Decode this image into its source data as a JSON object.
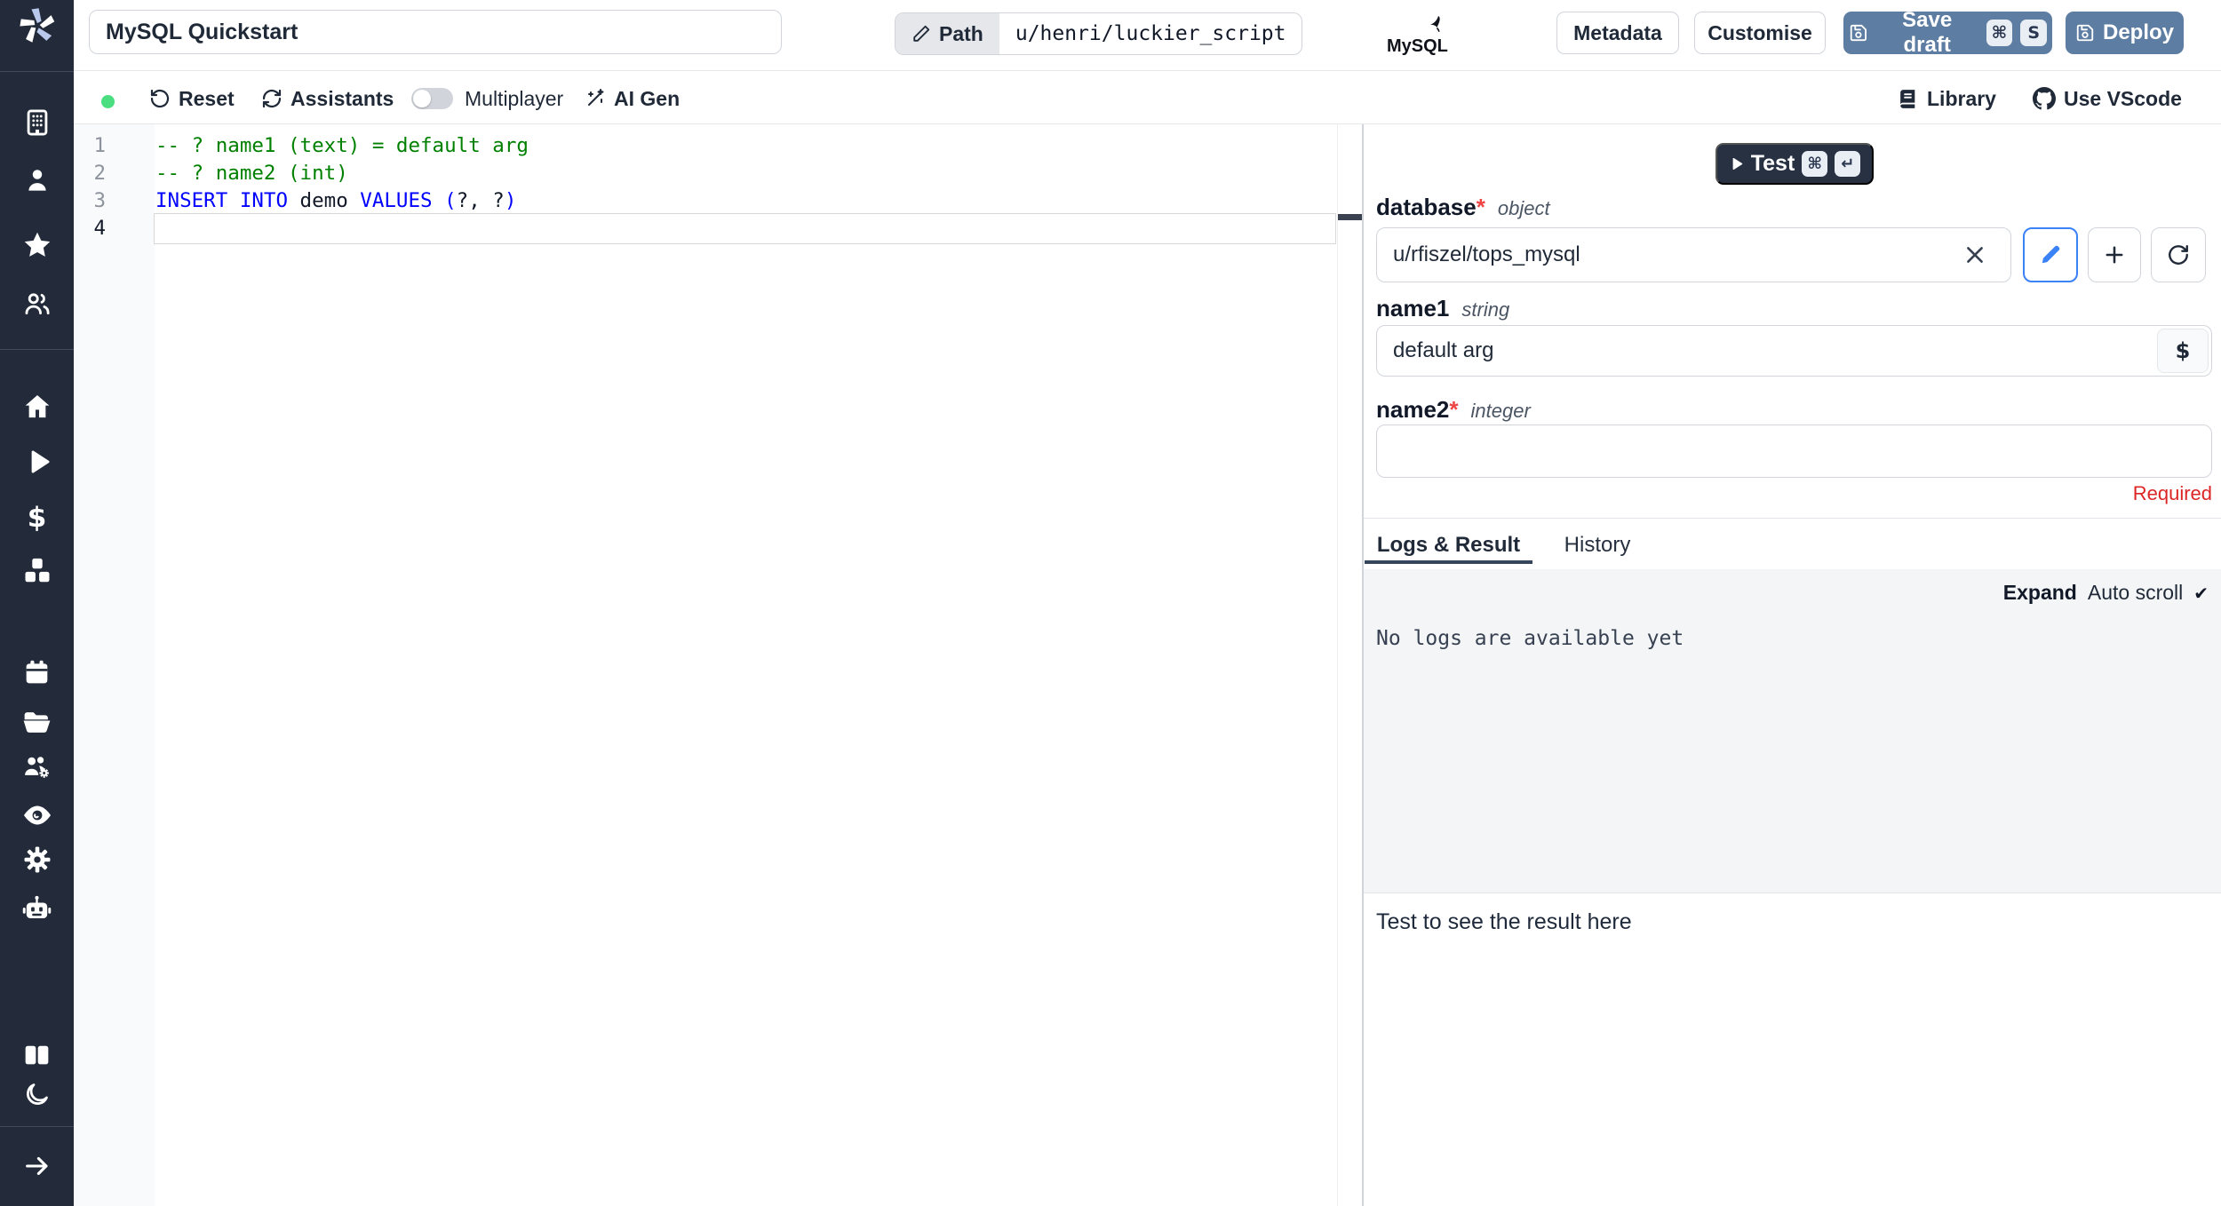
{
  "topbar": {
    "title_value": "MySQL Quickstart",
    "path_label": "Path",
    "path_value": "u/henri/luckier_script",
    "language_logo_text": "MySQL",
    "metadata_label": "Metadata",
    "customise_label": "Customise",
    "save_draft_label": "Save draft",
    "save_draft_kbd1": "⌘",
    "save_draft_kbd2": "S",
    "deploy_label": "Deploy"
  },
  "toolbar": {
    "reset_label": "Reset",
    "assistants_label": "Assistants",
    "multiplayer_label": "Multiplayer",
    "ai_gen_label": "AI Gen",
    "library_label": "Library",
    "vscode_label": "Use VScode"
  },
  "editor": {
    "line_numbers": [
      "1",
      "2",
      "3",
      "4"
    ],
    "line1": "-- ? name1 (text) = default arg",
    "line2": "-- ? name2 (int)",
    "l3_kw1": "INSERT INTO",
    "l3_id": " demo ",
    "l3_kw2": "VALUES",
    "l3_p1": " (",
    "l3_q": "?, ?",
    "l3_p2": ")"
  },
  "panel": {
    "test_label": "Test",
    "test_kbd1": "⌘",
    "test_kbd2": "↵",
    "fields": {
      "database": {
        "name": "database",
        "required": "*",
        "type": "object",
        "value": "u/rfiszel/tops_mysql"
      },
      "name1": {
        "name": "name1",
        "type": "string",
        "value": "default arg",
        "var_button": "$"
      },
      "name2": {
        "name": "name2",
        "required": "*",
        "type": "integer",
        "value": "",
        "error": "Required"
      }
    },
    "tabs": {
      "logs": "Logs & Result",
      "history": "History"
    },
    "logs": {
      "expand_label": "Expand",
      "autoscroll_label": "Auto scroll",
      "check": "✔",
      "empty_text": "No logs are available yet"
    },
    "result_placeholder": "Test to see the result here"
  },
  "sidebar": {
    "icon_names": [
      "windmill-logo",
      "workspace",
      "user",
      "favorites",
      "groups",
      "home",
      "runs",
      "billing",
      "resources",
      "schedules",
      "folders",
      "workers",
      "audit-logs",
      "settings",
      "ai-assistant",
      "docs",
      "dark-mode",
      "collapse"
    ],
    "billing_icon_glyph": "$"
  },
  "colors": {
    "sidebar_bg": "#232b3a",
    "accent_button": "#5e7da2",
    "dark_button": "#273142",
    "keyword_blue": "#0000ff",
    "comment_green": "#008000",
    "required_red": "#dc2626",
    "status_green": "#4ade80",
    "focus_blue": "#3b82f6"
  }
}
